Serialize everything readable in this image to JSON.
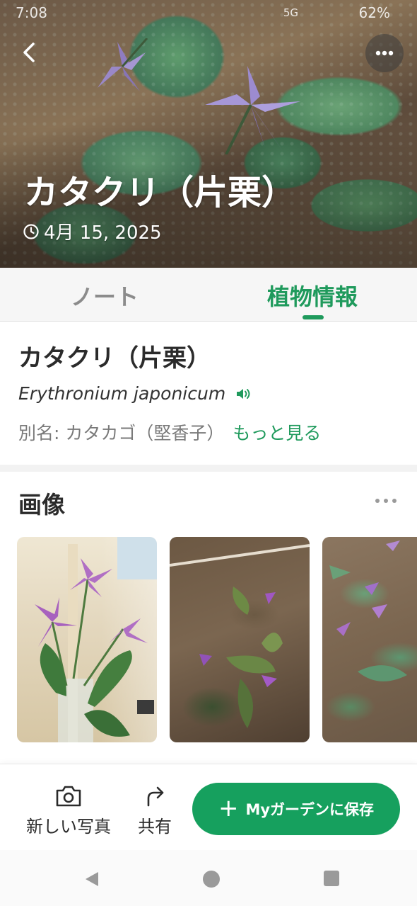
{
  "status_bar": {
    "time": "7:08",
    "network": "5G",
    "battery": "62%"
  },
  "hero": {
    "title": "カタクリ（片栗）",
    "date": "4月 15, 2025"
  },
  "tabs": [
    {
      "label": "ノート",
      "active": false
    },
    {
      "label": "植物情報",
      "active": true
    }
  ],
  "plant": {
    "name": "カタクリ（片栗）",
    "scientific_name": "Erythronium japonicum",
    "alias": "別名: カタカゴ（堅香子）",
    "more_link": "もっと見る"
  },
  "images_section": {
    "title": "画像"
  },
  "actions": {
    "new_photo": "新しい写真",
    "share": "共有",
    "save": "Myガーデンに保存"
  },
  "colors": {
    "accent": "#1f9a5c",
    "save_button": "#16a05e"
  }
}
